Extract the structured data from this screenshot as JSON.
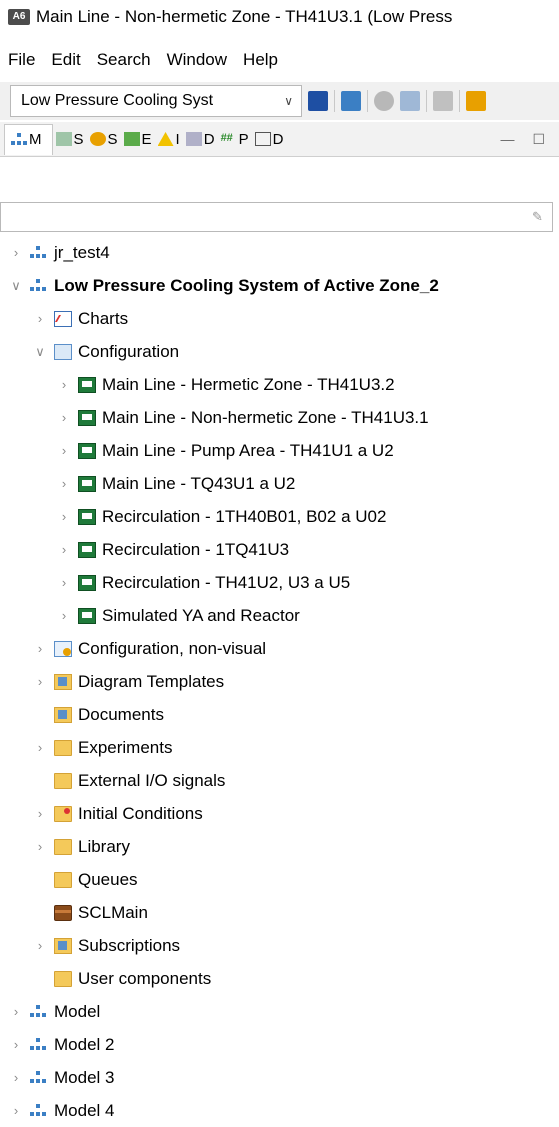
{
  "window": {
    "title": "Main Line - Non-hermetic Zone - TH41U3.1 (Low Press",
    "app_badge": "A6"
  },
  "menu": [
    "File",
    "Edit",
    "Search",
    "Window",
    "Help"
  ],
  "toolbar": {
    "combo_value": "Low Pressure Cooling Syst"
  },
  "view_tabs": [
    {
      "label": "M"
    },
    {
      "label": "S"
    },
    {
      "label": "S"
    },
    {
      "label": "E"
    },
    {
      "label": "I"
    },
    {
      "label": "D"
    },
    {
      "label": "P"
    },
    {
      "label": "D"
    }
  ],
  "filter": {
    "value": ""
  },
  "tree": [
    {
      "label": "jr_test4",
      "icon": "network-icon",
      "depth": 0,
      "expander": "collapsed"
    },
    {
      "label": "Low Pressure Cooling System of Active Zone_2",
      "icon": "network-icon",
      "depth": 0,
      "expander": "expanded",
      "bold": true
    },
    {
      "label": "Charts",
      "icon": "chart-icon",
      "depth": 1,
      "expander": "collapsed"
    },
    {
      "label": "Configuration",
      "icon": "configuration-icon",
      "depth": 1,
      "expander": "expanded"
    },
    {
      "label": "Main Line - Hermetic Zone - TH41U3.2",
      "icon": "screen-icon",
      "depth": 2,
      "expander": "collapsed"
    },
    {
      "label": "Main Line - Non-hermetic Zone - TH41U3.1",
      "icon": "screen-icon",
      "depth": 2,
      "expander": "collapsed"
    },
    {
      "label": "Main Line - Pump Area - TH41U1 a U2",
      "icon": "screen-icon",
      "depth": 2,
      "expander": "collapsed"
    },
    {
      "label": "Main Line - TQ43U1 a U2",
      "icon": "screen-icon",
      "depth": 2,
      "expander": "collapsed"
    },
    {
      "label": "Recirculation - 1TH40B01, B02 a U02",
      "icon": "screen-icon",
      "depth": 2,
      "expander": "collapsed"
    },
    {
      "label": "Recirculation - 1TQ41U3",
      "icon": "screen-icon",
      "depth": 2,
      "expander": "collapsed"
    },
    {
      "label": "Recirculation - TH41U2, U3 a U5",
      "icon": "screen-icon",
      "depth": 2,
      "expander": "collapsed"
    },
    {
      "label": "Simulated YA and Reactor",
      "icon": "screen-icon",
      "depth": 2,
      "expander": "collapsed"
    },
    {
      "label": "Configuration, non-visual",
      "icon": "configuration-nonvisual-icon",
      "depth": 1,
      "expander": "collapsed"
    },
    {
      "label": "Diagram Templates",
      "icon": "diagram-templates-folder-icon",
      "depth": 1,
      "expander": "collapsed"
    },
    {
      "label": "Documents",
      "icon": "documents-folder-icon",
      "depth": 1,
      "expander": "none"
    },
    {
      "label": "Experiments",
      "icon": "folder-icon",
      "depth": 1,
      "expander": "collapsed"
    },
    {
      "label": "External I/O signals",
      "icon": "folder-icon",
      "depth": 1,
      "expander": "none"
    },
    {
      "label": "Initial Conditions",
      "icon": "initial-conditions-folder-icon",
      "depth": 1,
      "expander": "collapsed"
    },
    {
      "label": "Library",
      "icon": "folder-icon",
      "depth": 1,
      "expander": "collapsed"
    },
    {
      "label": "Queues",
      "icon": "queues-folder-icon",
      "depth": 1,
      "expander": "none"
    },
    {
      "label": "SCLMain",
      "icon": "scl-icon",
      "depth": 1,
      "expander": "none"
    },
    {
      "label": "Subscriptions",
      "icon": "subscriptions-folder-icon",
      "depth": 1,
      "expander": "collapsed"
    },
    {
      "label": "User components",
      "icon": "folder-icon",
      "depth": 1,
      "expander": "none"
    },
    {
      "label": "Model",
      "icon": "network-icon",
      "depth": 0,
      "expander": "collapsed"
    },
    {
      "label": "Model 2",
      "icon": "network-icon",
      "depth": 0,
      "expander": "collapsed"
    },
    {
      "label": "Model 3",
      "icon": "network-icon",
      "depth": 0,
      "expander": "collapsed"
    },
    {
      "label": "Model 4",
      "icon": "network-icon",
      "depth": 0,
      "expander": "collapsed"
    }
  ]
}
